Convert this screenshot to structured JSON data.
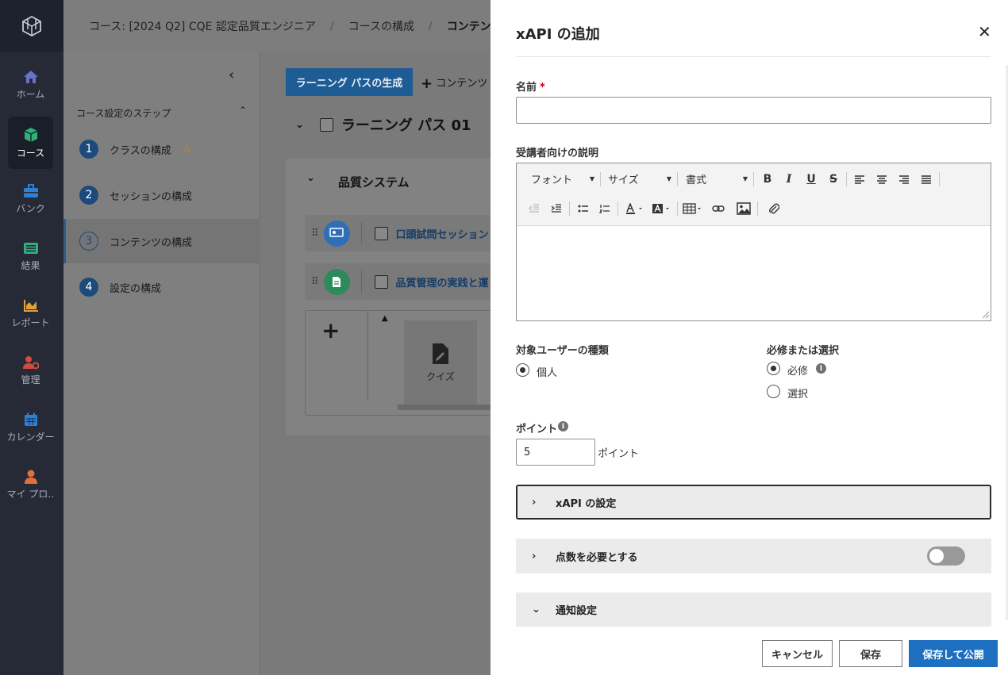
{
  "nav": {
    "items": [
      {
        "label": "ホーム",
        "icon": "home-icon"
      },
      {
        "label": "コース",
        "icon": "course-cube-icon"
      },
      {
        "label": "バンク",
        "icon": "bank-toolbox-icon"
      },
      {
        "label": "結果",
        "icon": "results-list-icon"
      },
      {
        "label": "レポート",
        "icon": "report-chart-icon"
      },
      {
        "label": "管理",
        "icon": "admin-user-gear-icon"
      },
      {
        "label": "カレンダー",
        "icon": "calendar-icon"
      },
      {
        "label": "マイ プロ…",
        "icon": "profile-person-icon"
      }
    ]
  },
  "breadcrumb": {
    "course": "コース: [2024 Q2] CQE 認定品質エンジニア",
    "structure": "コースの構成",
    "current": "コンテンツの構成"
  },
  "steps": {
    "header": "コース設定のステップ",
    "items": [
      {
        "num": "1",
        "label": "クラスの構成"
      },
      {
        "num": "2",
        "label": "セッションの構成"
      },
      {
        "num": "3",
        "label": "コンテンツの構成"
      },
      {
        "num": "4",
        "label": "設定の構成"
      }
    ]
  },
  "content": {
    "learning_path_button": "ラーニング パスの生成",
    "add_content_label": "コンテンツ ク",
    "learning_path_title": "ラーニング パス 01",
    "section_title": "品質システム",
    "items": [
      {
        "label": "口頭試問セッション"
      },
      {
        "label": "品質管理の実践と運"
      }
    ],
    "tile_quiz": "クイズ"
  },
  "panel": {
    "title": "xAPI の追加",
    "name_label": "名前",
    "name_value": "",
    "desc_label": "受講者向けの説明",
    "toolbar": {
      "font": "フォント",
      "size": "サイズ",
      "format": "書式",
      "bold": "B",
      "italic": "I",
      "underline": "U",
      "strike": "S"
    },
    "audience_label": "対象ユーザーの種類",
    "audience_individual": "個人",
    "required_label": "必修または選択",
    "required_option": "必修",
    "optional_option": "選択",
    "points_label": "ポイント",
    "points_value": "5",
    "points_unit": "ポイント",
    "xapi_settings": "xAPI の設定",
    "require_score": "点数を必要とする",
    "require_score_on": false,
    "notification_settings": "通知設定",
    "cancel": "キャンセル",
    "save": "保存",
    "save_publish": "保存して公開"
  },
  "colors": {
    "primary": "#1d6fbf",
    "nav_bg": "#262a37",
    "required_mark": "#d0021b"
  }
}
